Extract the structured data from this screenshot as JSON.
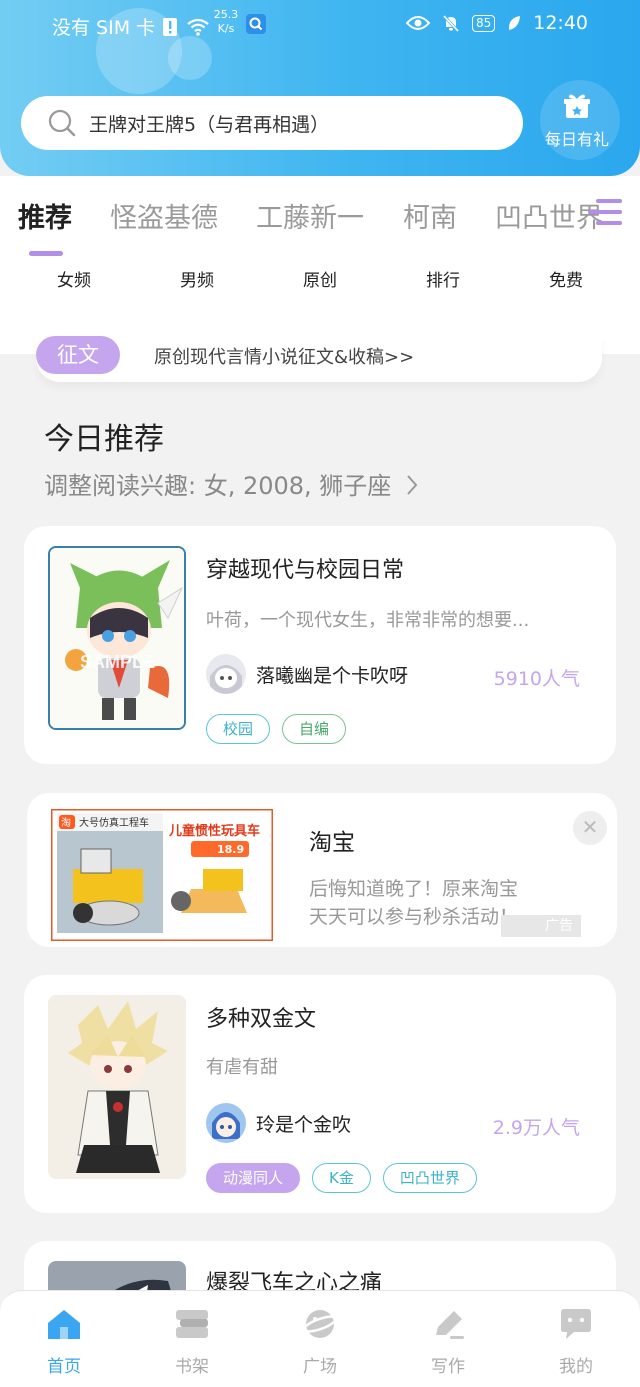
{
  "status_bar": {
    "carrier": "没有 SIM 卡",
    "speed_value": "25.3",
    "speed_unit": "K/s",
    "battery": "85",
    "time": "12:40"
  },
  "header": {
    "search_query": "王牌对王牌5（与君再相遇）",
    "gift_label": "每日有礼"
  },
  "tabs": [
    {
      "label": "推荐"
    },
    {
      "label": "怪盗基德"
    },
    {
      "label": "工藤新一"
    },
    {
      "label": "柯南"
    },
    {
      "label": "凹凸世界"
    }
  ],
  "subcategories": [
    "女频",
    "男频",
    "原创",
    "排行",
    "免费"
  ],
  "contest": {
    "pill": "征文",
    "text": "原创现代言情小说征文&收稿>>"
  },
  "today": {
    "title": "今日推荐",
    "interest": "调整阅读兴趣: 女, 2008, 狮子座"
  },
  "books": [
    {
      "title": "穿越现代与校园日常",
      "desc": "叶荷，一个现代女生，非常非常的想要...",
      "author": "落曦幽是个卡吹呀",
      "popularity": "5910人气",
      "tags": [
        "校园",
        "自编"
      ]
    },
    {
      "title": "多种双金文",
      "desc": "有虐有甜",
      "author": "玲是个金吹",
      "popularity": "2.9万人气",
      "tags": [
        "动漫同人",
        "K金",
        "凹凸世界"
      ]
    },
    {
      "title": "爆裂飞车之心之痛"
    }
  ],
  "ad": {
    "title": "淘宝",
    "desc_line1": "后悔知道晚了！原来淘宝",
    "desc_line2": "天天可以参与秒杀活动！",
    "badge": "广告",
    "image_tag": "淘",
    "image_caption": "大号仿真工程车",
    "image_headline": "儿童惯性玩具车",
    "image_price": "18.9"
  },
  "bottom_nav": [
    {
      "label": "首页",
      "icon": "home-icon"
    },
    {
      "label": "书架",
      "icon": "bookshelf-icon"
    },
    {
      "label": "广场",
      "icon": "planet-icon"
    },
    {
      "label": "写作",
      "icon": "pen-icon"
    },
    {
      "label": "我的",
      "icon": "chat-bubble-icon"
    }
  ],
  "colors": {
    "header_blue": "#3fb5f0",
    "accent_purple": "#c5a6ee",
    "nav_active": "#3aa5f0"
  }
}
